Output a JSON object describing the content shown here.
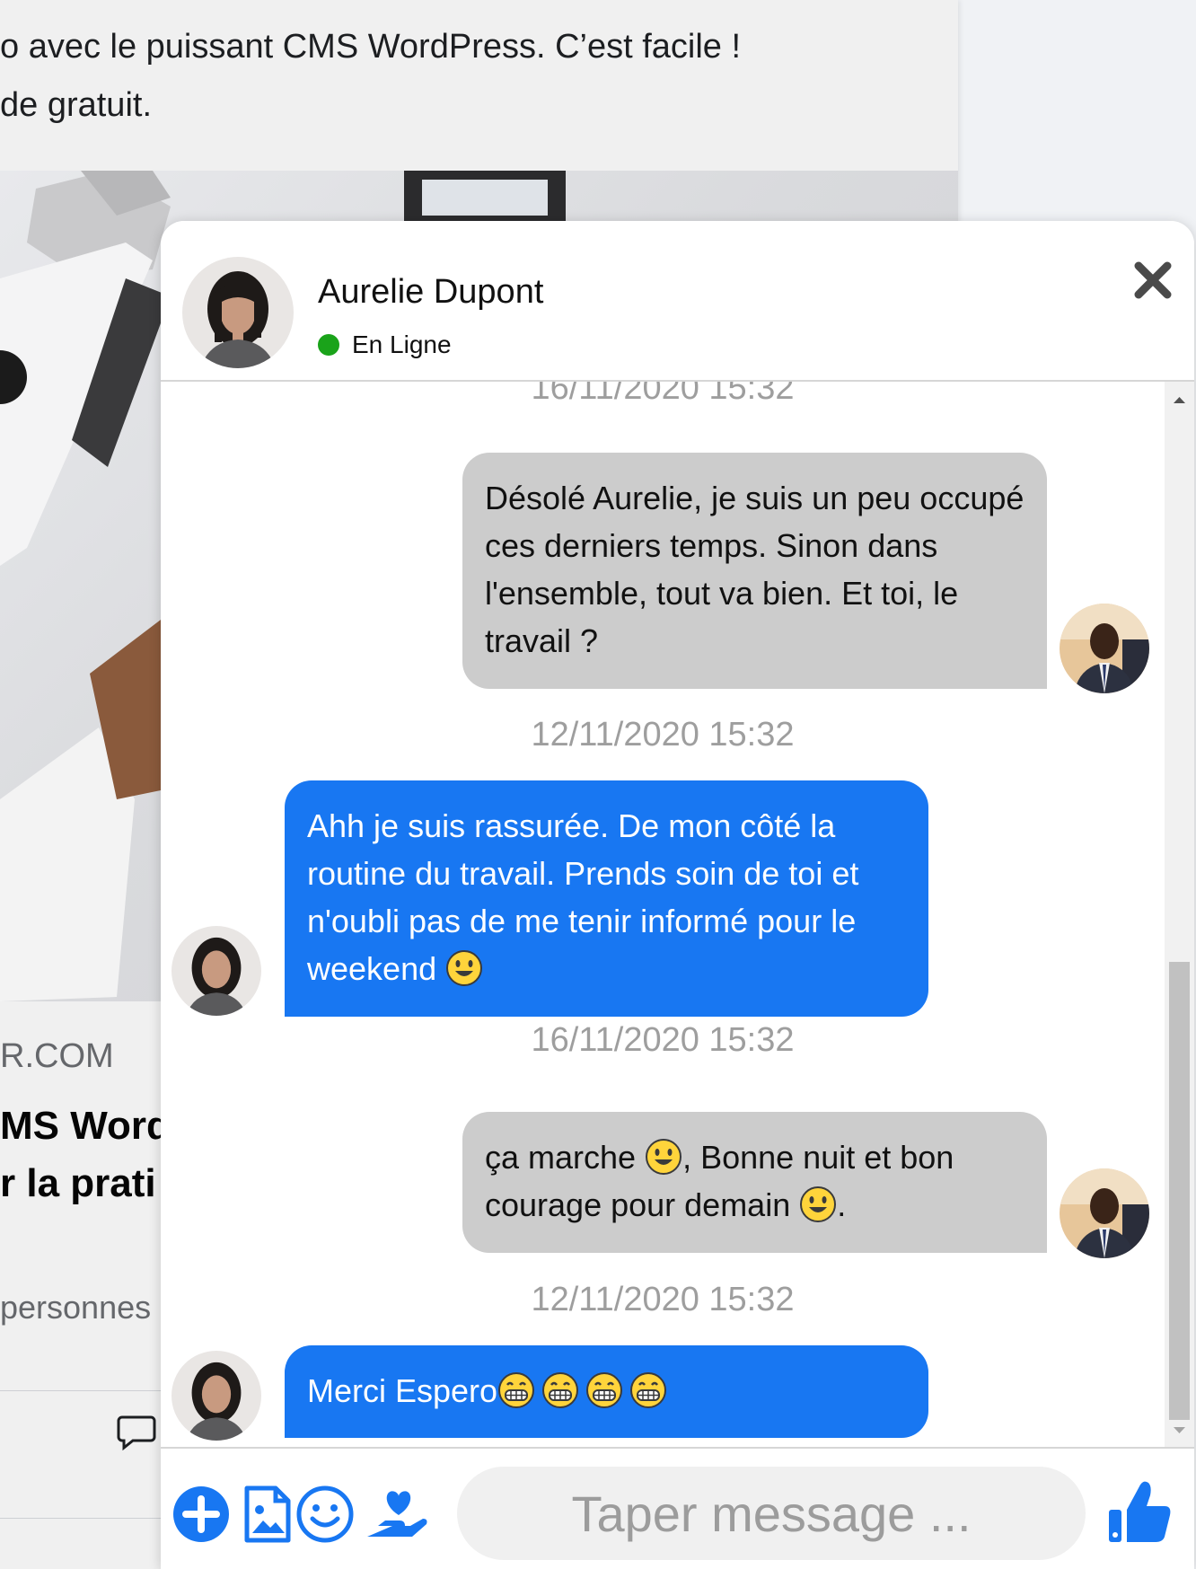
{
  "background_post": {
    "text_line1": "o avec le puissant CMS WordPress. C’est facile !",
    "text_line2": "de gratuit.",
    "site": "R.COM",
    "title_line1": "MS Word",
    "title_line2": "r la prati",
    "people": "personnes"
  },
  "chat": {
    "contact": {
      "name": "Aurelie Dupont",
      "status": "En Ligne",
      "status_color": "#1aa31a"
    },
    "messages": [
      {
        "type": "timestamp",
        "text": "16/11/2020 15:32"
      },
      {
        "type": "outgoing",
        "text": "Désolé Aurelie, je suis un peu occupé ces derniers temps. Sinon dans l'ensemble, tout va bien. Et toi, le travail ?"
      },
      {
        "type": "timestamp",
        "text": "12/11/2020 15:32"
      },
      {
        "type": "incoming",
        "text": "Ahh je suis rassurée. De mon côté la routine du travail. Prends soin de toi et n'oubli pas de me tenir informé pour le weekend",
        "emoji": "smiley-emoji"
      },
      {
        "type": "timestamp",
        "text": "16/11/2020 15:32"
      },
      {
        "type": "outgoing",
        "text_a": "ça marche ",
        "text_b": ", Bonne nuit et bon courage pour demain ",
        "text_c": ".",
        "emoji": "smiley-emoji"
      },
      {
        "type": "timestamp",
        "text": "12/11/2020 15:32"
      },
      {
        "type": "incoming",
        "text": "Merci Espero",
        "emoji": "grin-emoji",
        "emoji_count": 4
      }
    ],
    "input": {
      "placeholder": "Taper message ..."
    },
    "toolbar": {
      "icons": [
        "plus-circle-icon",
        "image-file-icon",
        "smile-icon",
        "heart-hand-icon",
        "thumbs-up-icon"
      ],
      "accent_color": "#1877f2"
    }
  }
}
